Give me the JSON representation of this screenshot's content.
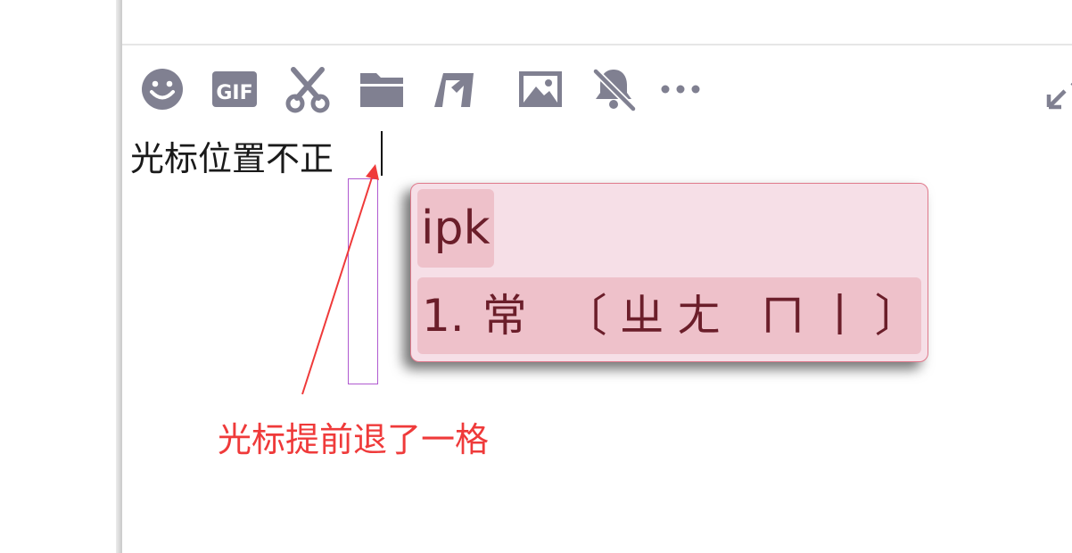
{
  "toolbar": {
    "icons": [
      "smiley-icon",
      "gif-icon",
      "scissors-icon",
      "folder-icon",
      "shortcut-icon",
      "image-icon",
      "bell-off-icon",
      "more-icon",
      "expand-icon"
    ],
    "gif_label": "GIF",
    "icon_color": "#808091"
  },
  "editor": {
    "text": "光标位置不正"
  },
  "ime": {
    "preedit": "ipk",
    "candidate_index": "1.",
    "candidate_word": "常",
    "candidate_hint": "〔ㄓㄤ ㄇ丨〕"
  },
  "annotation": {
    "text": "光标提前退了一格",
    "color": "#ef3a3a"
  }
}
